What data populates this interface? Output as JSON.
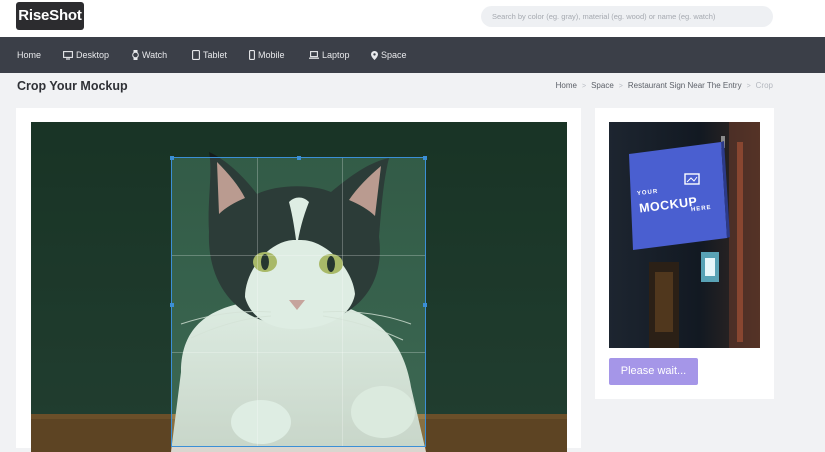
{
  "header": {
    "logo": "RiseShot",
    "search_placeholder": "Search by color (eg. gray), material (eg. wood) or name (eg. watch)"
  },
  "nav": {
    "items": [
      {
        "label": "Home",
        "icon": ""
      },
      {
        "label": "Desktop",
        "icon": "desktop-icon"
      },
      {
        "label": "Watch",
        "icon": "watch-icon"
      },
      {
        "label": "Tablet",
        "icon": "tablet-icon"
      },
      {
        "label": "Mobile",
        "icon": "mobile-icon"
      },
      {
        "label": "Laptop",
        "icon": "laptop-icon"
      },
      {
        "label": "Space",
        "icon": "location-pin-icon"
      }
    ]
  },
  "page": {
    "title": "Crop Your Mockup"
  },
  "breadcrumb": {
    "items": [
      "Home",
      "Space",
      "Restaurant Sign Near The Entry",
      "Crop"
    ],
    "separator": ">"
  },
  "preview": {
    "sign_line1": "YOUR",
    "sign_line2": "MOCKUP",
    "sign_line3": "HERE"
  },
  "action": {
    "wait_label": "Please wait..."
  },
  "colors": {
    "nav_bg": "#3b3f48",
    "accent_button": "#a596e8",
    "crop_border": "#3b8fd6",
    "sign_blue": "#4a5fd0"
  }
}
